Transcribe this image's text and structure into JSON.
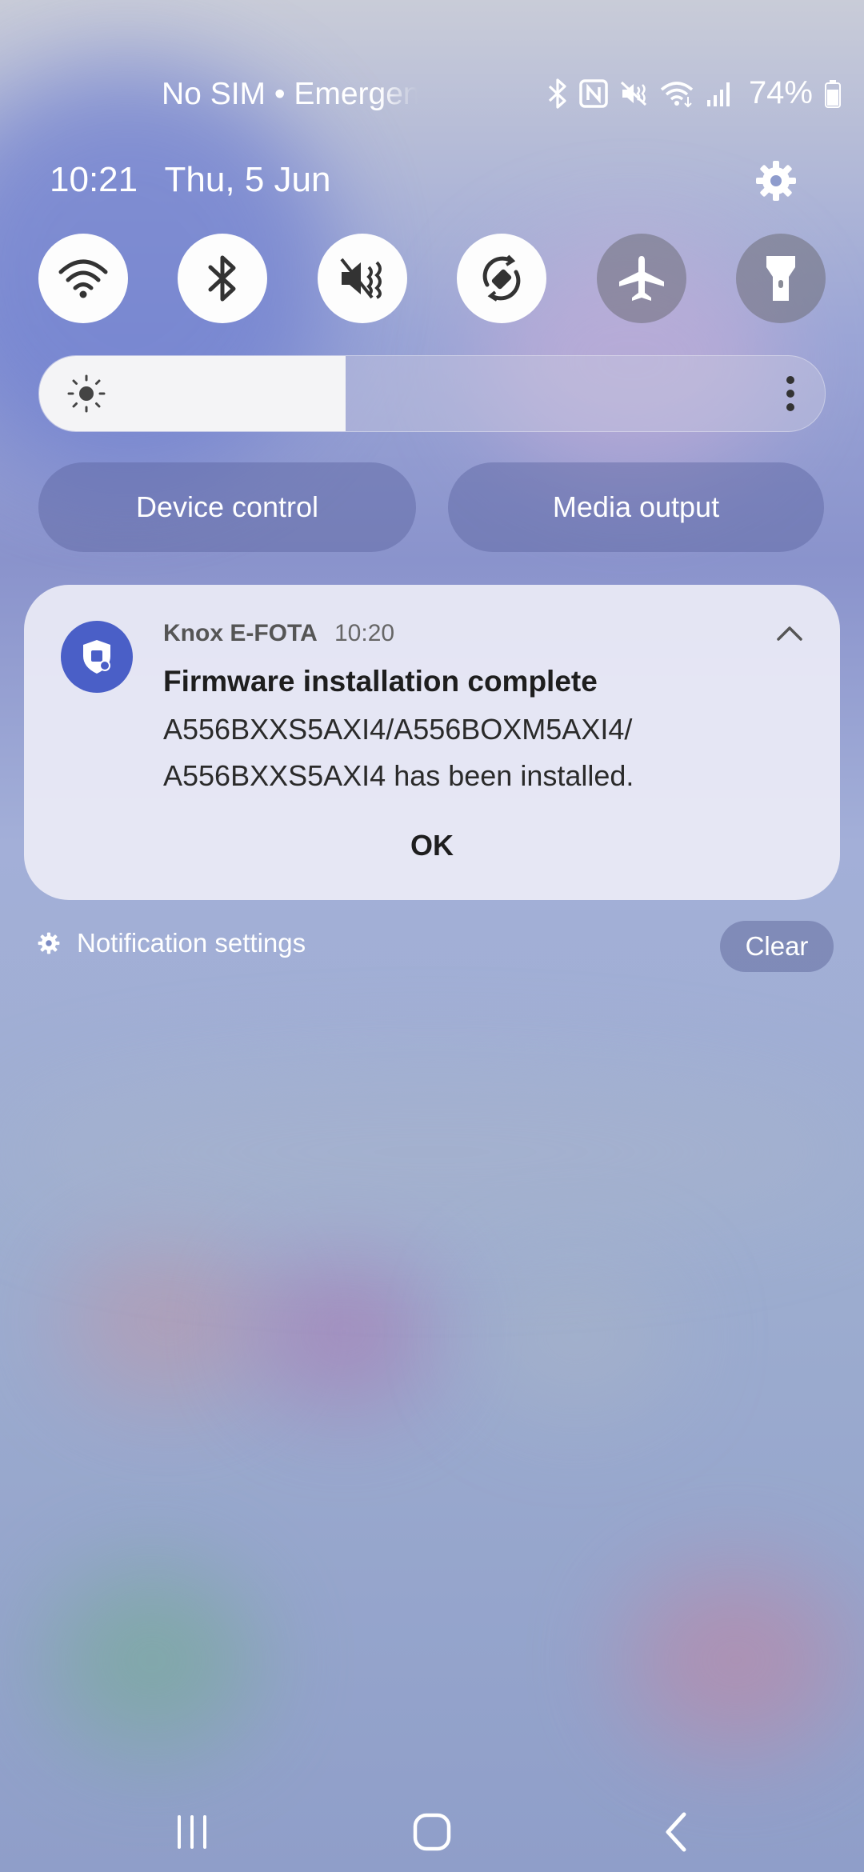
{
  "status_bar": {
    "carrier_text": "No SIM • Emergen",
    "battery_percent": "74%",
    "icons": [
      "bluetooth-icon",
      "nfc-icon",
      "mute-icon",
      "wifi-icon",
      "signal-icon",
      "battery-icon"
    ]
  },
  "header": {
    "time": "10:21",
    "date": "Thu, 5 Jun"
  },
  "quick_settings": [
    {
      "name": "wifi",
      "state": "on"
    },
    {
      "name": "bluetooth",
      "state": "on"
    },
    {
      "name": "mute",
      "state": "on"
    },
    {
      "name": "auto-rotate",
      "state": "on"
    },
    {
      "name": "airplane-mode",
      "state": "off"
    },
    {
      "name": "flashlight",
      "state": "off"
    }
  ],
  "brightness": {
    "level": 0.39
  },
  "buttons": {
    "device_control": "Device control",
    "media_output": "Media output"
  },
  "notification": {
    "app_name": "Knox E-FOTA",
    "time": "10:20",
    "title": "Firmware installation complete",
    "body": "A556BXXS5AXI4/A556BOXM5AXI4/ A556BXXS5AXI4 has been installed.",
    "action": "OK"
  },
  "footer": {
    "notification_settings": "Notification settings",
    "clear": "Clear"
  },
  "colors": {
    "app_icon_bg": "#4a5fc7",
    "accent_white": "#ffffff"
  }
}
